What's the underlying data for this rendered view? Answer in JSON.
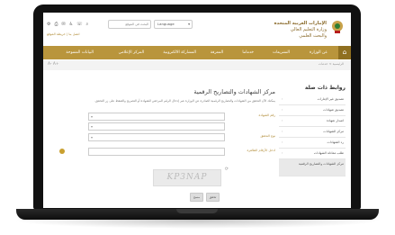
{
  "header": {
    "org_line1": "الإمارات العربية المتحدة",
    "org_line2": "وزارة التعليم العالي",
    "org_line3": "والبحث العلمي",
    "language_label": "Language",
    "search_placeholder": "البحث في الموقع",
    "sublinks": "اتصل بنا | خريطة الموقع"
  },
  "nav": {
    "items": [
      "عن الوزارة",
      "التشريعات",
      "خدماتنا",
      "المعرفة",
      "المشاركة الالكترونية",
      "المركز الإعلامي",
      "البيانات المفتوحة"
    ]
  },
  "toolbar": {
    "font_sizes": "A-  A+",
    "breadcrumb": "الرئيسية > خدمات"
  },
  "sidebar": {
    "title": "روابط ذات صلة",
    "items": [
      "تصديق غير الإمارات",
      "تصديق شهادات",
      "اصدار شهادة",
      "مركز الشهادات",
      "رد الشهادات",
      "طلب معادلة الشهادات",
      "مركز الشهادات والتصاريح الرقمية"
    ]
  },
  "main": {
    "title": "مركز الشهادات والتصاريح الرقمية",
    "intro": "يمكنك الآن التحقق من الشهادات والتصاريح الرقمية الصادرة عن الوزارة عبر إدخال الرقم المرجعي للشهادة أو التصريح والضغط على زر التحقق.",
    "fields": [
      {
        "label": "رقم الشهادة"
      },
      {
        "label": "نوع التحقق"
      },
      {
        "label": "ادخل الأرقام الظاهرة"
      }
    ],
    "captcha_text": "KP3NAP",
    "buttons": {
      "submit": "تحقق",
      "reset": "مسح"
    }
  }
}
